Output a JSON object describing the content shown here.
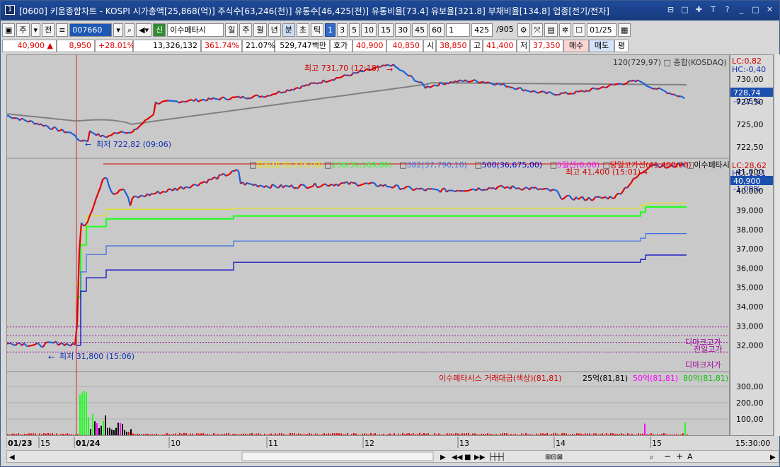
{
  "window": {
    "number": "1",
    "title": "[0600] 키움종합차트 - KOSPI 시가총액[25,868(억)] 주식수[63,246(천)] 유통수[46,425(천)] 유통비율[73.4] 유보율[321.8] 부채비율[134.8] 업종[전기/전자]"
  },
  "toolbar": {
    "period_week": "주",
    "prev": "전",
    "code": "007660",
    "new_badge": "신",
    "name": "이수페타시",
    "tabs": [
      "일",
      "주",
      "월",
      "년",
      "분",
      "초",
      "틱"
    ],
    "selected_tab": "분",
    "intervals": [
      "1",
      "3",
      "5",
      "10",
      "15",
      "30",
      "45",
      "60"
    ],
    "selected_interval": "1",
    "count_select": "1",
    "count": "425",
    "total": "/905",
    "date": "01/25"
  },
  "quote": {
    "price": "40,900",
    "change": "8,950",
    "change_pct": "+28.01%",
    "volume": "13,326,132",
    "vol_ratio": "361.74%",
    "turnover": "21.07%",
    "amount": "529,747백만",
    "bid_label": "호가",
    "ask": "40,900",
    "bid": "40,850",
    "open_label": "시",
    "open": "38,850",
    "high_label": "고",
    "high": "41,400",
    "low_label": "저",
    "low": "37,350",
    "buy": "매수",
    "sell": "매도",
    "eval": "평"
  },
  "panel_top": {
    "legend": "120(729,97) □ 종합(KOSDAQ)",
    "max_label": "최고 731,70 (12:18)",
    "min_label": "최저 722,82 (09:06)",
    "lc": "LC:0,82",
    "hc": "HC:-0,40",
    "current": "728,74",
    "current_chg": "-0,05%",
    "ticks": [
      "730,00",
      "727,50",
      "725,00",
      "722,50"
    ]
  },
  "panel_mid": {
    "legends": [
      {
        "text": "중심선(39,375,00)",
        "color": "#e8e800"
      },
      {
        "text": "236(39,169,80)",
        "color": "#22ff22"
      },
      {
        "text": "382(37,790,10)",
        "color": "#3a6fe6"
      },
      {
        "text": "500(36,675,00)",
        "color": "#0000c8"
      },
      {
        "text": "5일선(0,00)",
        "color": "#ff00ff"
      },
      {
        "text": "당일고가선(41,400,00)",
        "color": "#d80000"
      },
      {
        "text": "이수페타시스",
        "color": "#000000"
      }
    ],
    "max_label": "최고 41,400 (15:01)",
    "min_label": "최저 31,800 (15:06)",
    "lc": "LC:28,62",
    "hc": "HC:-1,21",
    "current": "40,900",
    "current_chg": "-1,09%",
    "ticks": [
      "41,000",
      "40,000",
      "39,000",
      "38,000",
      "37,000",
      "36,000",
      "35,000",
      "34,000",
      "33,000",
      "32,000"
    ],
    "dmark_high": "디마크고가",
    "prev_high": "전일고가",
    "dmark_low": "디마크저가"
  },
  "panel_vol": {
    "legend_title": "이수페타시스 거래대금(색상)(81,81)",
    "legend_25": "25억(81,81)",
    "legend_50": "50억(81,81)",
    "legend_80": "80억(81,81)",
    "ticks": [
      "300,00",
      "200,00",
      "100,00"
    ]
  },
  "xaxis": {
    "labels": [
      "01/23",
      "15",
      "01/24",
      "10",
      "11",
      "12",
      "13",
      "14",
      "15"
    ],
    "time": "15:30:00"
  },
  "colors": {
    "up": "#e00000",
    "down": "#1a5fd6",
    "title_bg": "#1f4b9b"
  },
  "icons": [
    "lock-icon",
    "restore-icon",
    "pin-icon",
    "font-icon",
    "help-icon",
    "minimize-icon",
    "maximize-icon",
    "close-icon"
  ]
}
